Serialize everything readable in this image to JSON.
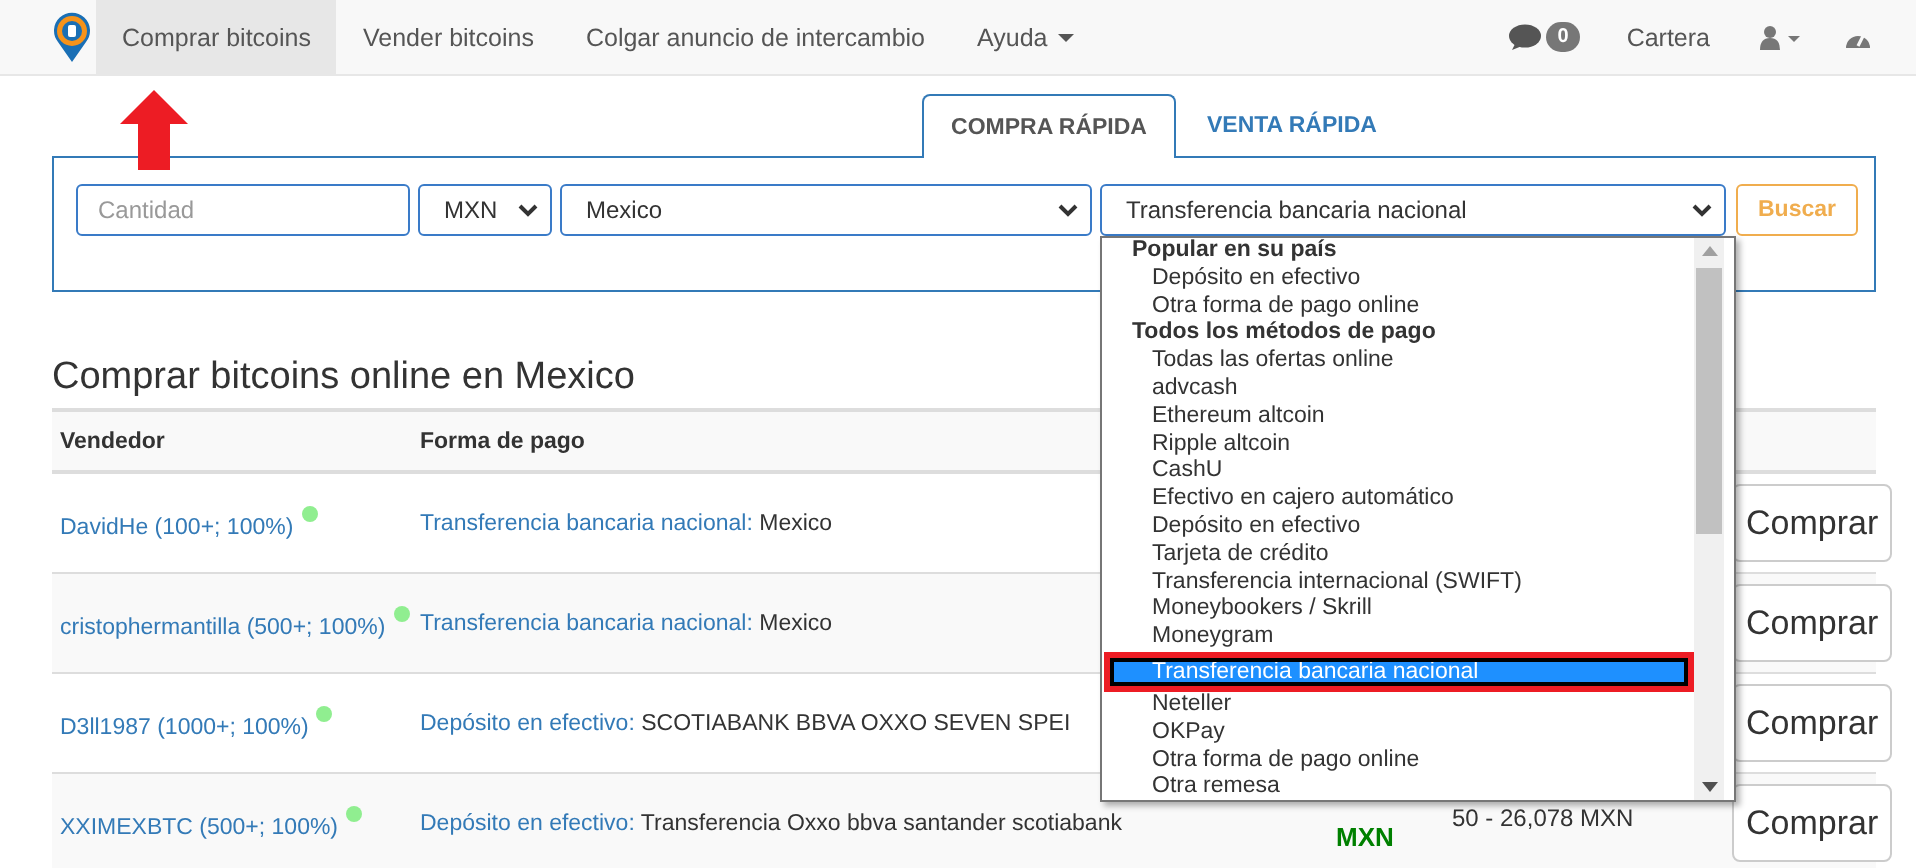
{
  "nav": {
    "items": [
      {
        "label": "Comprar bitcoins",
        "selected": true,
        "caret": false
      },
      {
        "label": "Vender bitcoins",
        "selected": false,
        "caret": false
      },
      {
        "label": "Colgar anuncio de intercambio",
        "selected": false,
        "caret": false
      },
      {
        "label": "Ayuda",
        "selected": false,
        "caret": true
      }
    ],
    "messages_badge": "0",
    "wallet": "Cartera"
  },
  "quick": {
    "tabs": [
      {
        "label": "COMPRA RÁPIDA",
        "selected": true
      },
      {
        "label": "VENTA RÁPIDA",
        "selected": false
      }
    ],
    "amount_placeholder": "Cantidad",
    "currency": "MXN",
    "country": "Mexico",
    "payment": "Transferencia bancaria nacional",
    "search_button": "Buscar",
    "dropdown": [
      {
        "kind": "group",
        "label": "Popular en su país"
      },
      {
        "kind": "option",
        "label": "Depósito en efectivo",
        "selected": false
      },
      {
        "kind": "option",
        "label": "Otra forma de pago online",
        "selected": false
      },
      {
        "kind": "group",
        "label": "Todos los métodos de pago"
      },
      {
        "kind": "option",
        "label": "Todas las ofertas online",
        "selected": false
      },
      {
        "kind": "option",
        "label": "advcash",
        "selected": false
      },
      {
        "kind": "option",
        "label": "Ethereum altcoin",
        "selected": false
      },
      {
        "kind": "option",
        "label": "Ripple altcoin",
        "selected": false
      },
      {
        "kind": "option",
        "label": "CashU",
        "selected": false
      },
      {
        "kind": "option",
        "label": "Efectivo en cajero automático",
        "selected": false
      },
      {
        "kind": "option",
        "label": "Depósito en efectivo",
        "selected": false
      },
      {
        "kind": "option",
        "label": "Tarjeta de crédito",
        "selected": false
      },
      {
        "kind": "option",
        "label": "Transferencia internacional (SWIFT)",
        "selected": false
      },
      {
        "kind": "option",
        "label": "Moneybookers / Skrill",
        "selected": false
      },
      {
        "kind": "option",
        "label": "Moneygram",
        "selected": false
      },
      {
        "kind": "option",
        "label": "Transferencia bancaria nacional",
        "selected": true
      },
      {
        "kind": "option",
        "label": "Neteller",
        "selected": false
      },
      {
        "kind": "option",
        "label": "OKPay",
        "selected": false
      },
      {
        "kind": "option",
        "label": "Otra forma de pago online",
        "selected": false
      },
      {
        "kind": "option",
        "label": "Otra remesa",
        "selected": false
      }
    ]
  },
  "heading": "Comprar bitcoins online en Mexico",
  "table": {
    "columns": [
      "Vendedor",
      "Forma de pago"
    ],
    "rows": [
      {
        "seller": "DavidHe (100+; 100%)",
        "online": true,
        "method": "Transferencia bancaria nacional:",
        "detail": "Mexico",
        "button": "Comprar"
      },
      {
        "seller": "cristophermantilla (500+; 100%)",
        "online": true,
        "method": "Transferencia bancaria nacional:",
        "detail": "Mexico",
        "button": "Comprar"
      },
      {
        "seller": "D3ll1987 (1000+; 100%)",
        "online": true,
        "method": "Depósito en efectivo:",
        "detail": "SCOTIABANK BBVA OXXO SEVEN SPEI",
        "button": "Comprar"
      },
      {
        "seller": "XXIMEXBTC (500+; 100%)",
        "online": true,
        "method": "Depósito en efectivo:",
        "detail": "Transferencia Oxxo bbva santander scotiabank",
        "column_3": "MXN",
        "column_4": "50 - 26,078 MXN",
        "button": "Comprar"
      }
    ]
  },
  "annotations": {
    "arrow": true,
    "frame": true
  }
}
